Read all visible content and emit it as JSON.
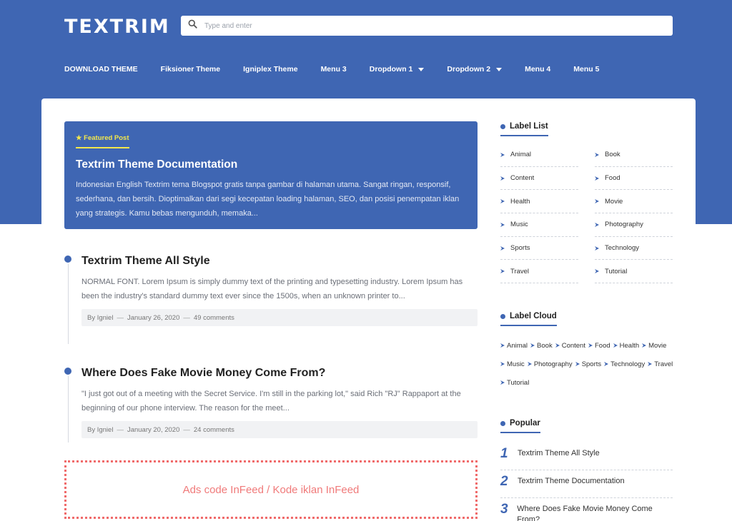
{
  "brand": {
    "logo": "TEXTRIM",
    "accent": "#3f66b3",
    "highlight": "#f4e84b"
  },
  "search": {
    "placeholder": "Type and enter",
    "icon": "search-icon"
  },
  "nav": [
    {
      "label": "DOWNLOAD THEME",
      "dropdown": false
    },
    {
      "label": "Fiksioner Theme",
      "dropdown": false
    },
    {
      "label": "Igniplex Theme",
      "dropdown": false
    },
    {
      "label": "Menu 3",
      "dropdown": false
    },
    {
      "label": "Dropdown 1",
      "dropdown": true
    },
    {
      "label": "Dropdown 2",
      "dropdown": true
    },
    {
      "label": "Menu 4",
      "dropdown": false
    },
    {
      "label": "Menu 5",
      "dropdown": false
    }
  ],
  "featured": {
    "badge": "★ Featured Post",
    "title": "Textrim Theme Documentation",
    "excerpt": "Indonesian English Textrim tema Blogspot gratis tanpa gambar di halaman utama. Sangat ringan, responsif, sederhana, dan bersih. Dioptimalkan dari segi kecepatan loading halaman, SEO, dan posisi penempatan iklan yang strategis. Kamu bebas mengunduh, memaka..."
  },
  "posts": [
    {
      "title": "Textrim Theme All Style",
      "excerpt": "NORMAL FONT. Lorem Ipsum is simply dummy text of the printing and typesetting industry. Lorem Ipsum has been the industry's standard dummy text ever since the 1500s, when an unknown printer to...",
      "author": "By Igniel",
      "date": "January 26, 2020",
      "comments": "49 comments"
    },
    {
      "title": "Where Does Fake Movie Money Come From?",
      "excerpt": "\"I just got out of a meeting with the Secret Service. I'm still in the parking lot,\" said Rich \"RJ\" Rappaport at the beginning of our phone interview. The reason for the meet...",
      "author": "By Igniel",
      "date": "January 20, 2020",
      "comments": "24 comments"
    }
  ],
  "meta_sep": "—",
  "ads": {
    "text": "Ads code InFeed / Kode iklan InFeed"
  },
  "sidebar": {
    "label_list": {
      "title": "Label List",
      "items": [
        "Animal",
        "Book",
        "Content",
        "Food",
        "Health",
        "Movie",
        "Music",
        "Photography",
        "Sports",
        "Technology",
        "Travel",
        "Tutorial"
      ]
    },
    "label_cloud": {
      "title": "Label Cloud",
      "items": [
        "Animal",
        "Book",
        "Content",
        "Food",
        "Health",
        "Movie",
        "Music",
        "Photography",
        "Sports",
        "Technology",
        "Travel",
        "Tutorial"
      ]
    },
    "popular": {
      "title": "Popular",
      "items": [
        {
          "num": "1",
          "title": "Textrim Theme All Style"
        },
        {
          "num": "2",
          "title": "Textrim Theme Documentation"
        },
        {
          "num": "3",
          "title": "Where Does Fake Movie Money Come From?"
        }
      ]
    }
  }
}
